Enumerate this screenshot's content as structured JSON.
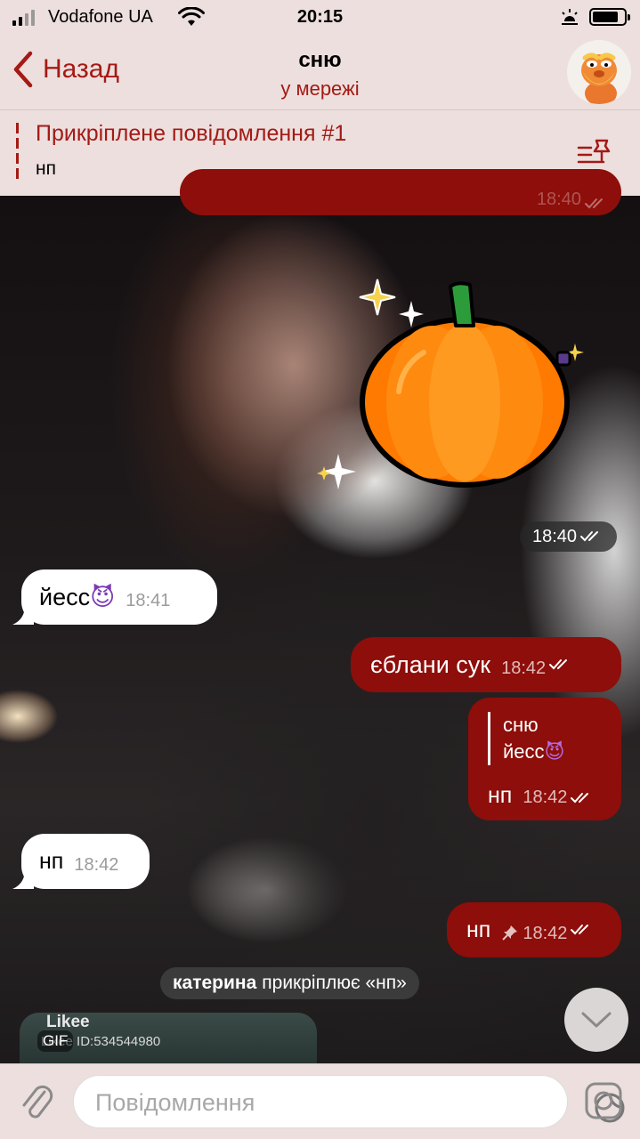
{
  "status_bar": {
    "carrier": "Vodafone UA",
    "time": "20:15"
  },
  "nav": {
    "back_label": "Назад",
    "title": "сню",
    "status": "у мережі"
  },
  "pinned": {
    "title": "Прикріплене повідомлення #1",
    "text": "нп"
  },
  "messages": [
    {
      "type": "outgoing",
      "time": "18:40",
      "cut_off": true
    },
    {
      "type": "sticker",
      "description": "pumpkin",
      "time": "18:40"
    },
    {
      "type": "incoming",
      "text": "йесс",
      "emoji": "😈",
      "time": "18:41"
    },
    {
      "type": "outgoing",
      "text": "єблани сук",
      "time": "18:42"
    },
    {
      "type": "outgoing",
      "reply_author": "сню",
      "reply_text": "йесс",
      "reply_emoji": "😈",
      "text": "нп",
      "time": "18:42"
    },
    {
      "type": "incoming",
      "text": "нп",
      "time": "18:42"
    },
    {
      "type": "outgoing",
      "text": "нп",
      "time": "18:42",
      "pinned": true
    }
  ],
  "service": {
    "author": "катерина",
    "action": "прикріплює «нп»"
  },
  "gif_preview": {
    "brand": "Likee",
    "id": "Likee ID:534544980",
    "badge": "GIF"
  },
  "input": {
    "placeholder": "Повідомлення"
  },
  "colors": {
    "accent": "#a41a14",
    "outgoing_bubble": "#8d0e0a",
    "bar_bg": "#ecdfde"
  },
  "icons": [
    "signal-icon",
    "wifi-icon",
    "alarm-icon",
    "battery-icon",
    "back-chevron-icon",
    "pin-list-icon",
    "read-checks-icon",
    "pin-icon",
    "chevron-down-icon",
    "paperclip-icon",
    "sticker-icon",
    "camera-icon"
  ]
}
